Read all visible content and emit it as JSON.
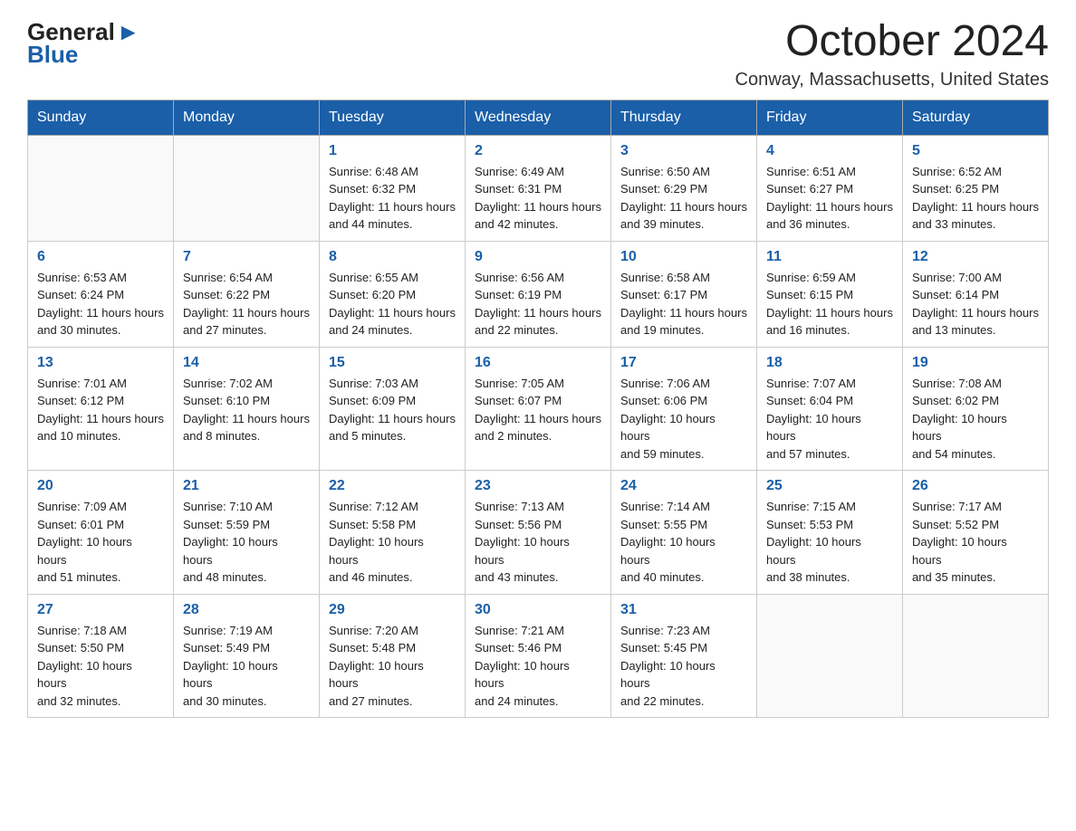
{
  "header": {
    "month_title": "October 2024",
    "location": "Conway, Massachusetts, United States",
    "logo_general": "General",
    "logo_blue": "Blue"
  },
  "days_of_week": [
    "Sunday",
    "Monday",
    "Tuesday",
    "Wednesday",
    "Thursday",
    "Friday",
    "Saturday"
  ],
  "weeks": [
    [
      {
        "day": "",
        "sunrise": "",
        "sunset": "",
        "daylight": ""
      },
      {
        "day": "",
        "sunrise": "",
        "sunset": "",
        "daylight": ""
      },
      {
        "day": "1",
        "sunrise": "Sunrise: 6:48 AM",
        "sunset": "Sunset: 6:32 PM",
        "daylight": "Daylight: 11 hours and 44 minutes."
      },
      {
        "day": "2",
        "sunrise": "Sunrise: 6:49 AM",
        "sunset": "Sunset: 6:31 PM",
        "daylight": "Daylight: 11 hours and 42 minutes."
      },
      {
        "day": "3",
        "sunrise": "Sunrise: 6:50 AM",
        "sunset": "Sunset: 6:29 PM",
        "daylight": "Daylight: 11 hours and 39 minutes."
      },
      {
        "day": "4",
        "sunrise": "Sunrise: 6:51 AM",
        "sunset": "Sunset: 6:27 PM",
        "daylight": "Daylight: 11 hours and 36 minutes."
      },
      {
        "day": "5",
        "sunrise": "Sunrise: 6:52 AM",
        "sunset": "Sunset: 6:25 PM",
        "daylight": "Daylight: 11 hours and 33 minutes."
      }
    ],
    [
      {
        "day": "6",
        "sunrise": "Sunrise: 6:53 AM",
        "sunset": "Sunset: 6:24 PM",
        "daylight": "Daylight: 11 hours and 30 minutes."
      },
      {
        "day": "7",
        "sunrise": "Sunrise: 6:54 AM",
        "sunset": "Sunset: 6:22 PM",
        "daylight": "Daylight: 11 hours and 27 minutes."
      },
      {
        "day": "8",
        "sunrise": "Sunrise: 6:55 AM",
        "sunset": "Sunset: 6:20 PM",
        "daylight": "Daylight: 11 hours and 24 minutes."
      },
      {
        "day": "9",
        "sunrise": "Sunrise: 6:56 AM",
        "sunset": "Sunset: 6:19 PM",
        "daylight": "Daylight: 11 hours and 22 minutes."
      },
      {
        "day": "10",
        "sunrise": "Sunrise: 6:58 AM",
        "sunset": "Sunset: 6:17 PM",
        "daylight": "Daylight: 11 hours and 19 minutes."
      },
      {
        "day": "11",
        "sunrise": "Sunrise: 6:59 AM",
        "sunset": "Sunset: 6:15 PM",
        "daylight": "Daylight: 11 hours and 16 minutes."
      },
      {
        "day": "12",
        "sunrise": "Sunrise: 7:00 AM",
        "sunset": "Sunset: 6:14 PM",
        "daylight": "Daylight: 11 hours and 13 minutes."
      }
    ],
    [
      {
        "day": "13",
        "sunrise": "Sunrise: 7:01 AM",
        "sunset": "Sunset: 6:12 PM",
        "daylight": "Daylight: 11 hours and 10 minutes."
      },
      {
        "day": "14",
        "sunrise": "Sunrise: 7:02 AM",
        "sunset": "Sunset: 6:10 PM",
        "daylight": "Daylight: 11 hours and 8 minutes."
      },
      {
        "day": "15",
        "sunrise": "Sunrise: 7:03 AM",
        "sunset": "Sunset: 6:09 PM",
        "daylight": "Daylight: 11 hours and 5 minutes."
      },
      {
        "day": "16",
        "sunrise": "Sunrise: 7:05 AM",
        "sunset": "Sunset: 6:07 PM",
        "daylight": "Daylight: 11 hours and 2 minutes."
      },
      {
        "day": "17",
        "sunrise": "Sunrise: 7:06 AM",
        "sunset": "Sunset: 6:06 PM",
        "daylight": "Daylight: 10 hours and 59 minutes."
      },
      {
        "day": "18",
        "sunrise": "Sunrise: 7:07 AM",
        "sunset": "Sunset: 6:04 PM",
        "daylight": "Daylight: 10 hours and 57 minutes."
      },
      {
        "day": "19",
        "sunrise": "Sunrise: 7:08 AM",
        "sunset": "Sunset: 6:02 PM",
        "daylight": "Daylight: 10 hours and 54 minutes."
      }
    ],
    [
      {
        "day": "20",
        "sunrise": "Sunrise: 7:09 AM",
        "sunset": "Sunset: 6:01 PM",
        "daylight": "Daylight: 10 hours and 51 minutes."
      },
      {
        "day": "21",
        "sunrise": "Sunrise: 7:10 AM",
        "sunset": "Sunset: 5:59 PM",
        "daylight": "Daylight: 10 hours and 48 minutes."
      },
      {
        "day": "22",
        "sunrise": "Sunrise: 7:12 AM",
        "sunset": "Sunset: 5:58 PM",
        "daylight": "Daylight: 10 hours and 46 minutes."
      },
      {
        "day": "23",
        "sunrise": "Sunrise: 7:13 AM",
        "sunset": "Sunset: 5:56 PM",
        "daylight": "Daylight: 10 hours and 43 minutes."
      },
      {
        "day": "24",
        "sunrise": "Sunrise: 7:14 AM",
        "sunset": "Sunset: 5:55 PM",
        "daylight": "Daylight: 10 hours and 40 minutes."
      },
      {
        "day": "25",
        "sunrise": "Sunrise: 7:15 AM",
        "sunset": "Sunset: 5:53 PM",
        "daylight": "Daylight: 10 hours and 38 minutes."
      },
      {
        "day": "26",
        "sunrise": "Sunrise: 7:17 AM",
        "sunset": "Sunset: 5:52 PM",
        "daylight": "Daylight: 10 hours and 35 minutes."
      }
    ],
    [
      {
        "day": "27",
        "sunrise": "Sunrise: 7:18 AM",
        "sunset": "Sunset: 5:50 PM",
        "daylight": "Daylight: 10 hours and 32 minutes."
      },
      {
        "day": "28",
        "sunrise": "Sunrise: 7:19 AM",
        "sunset": "Sunset: 5:49 PM",
        "daylight": "Daylight: 10 hours and 30 minutes."
      },
      {
        "day": "29",
        "sunrise": "Sunrise: 7:20 AM",
        "sunset": "Sunset: 5:48 PM",
        "daylight": "Daylight: 10 hours and 27 minutes."
      },
      {
        "day": "30",
        "sunrise": "Sunrise: 7:21 AM",
        "sunset": "Sunset: 5:46 PM",
        "daylight": "Daylight: 10 hours and 24 minutes."
      },
      {
        "day": "31",
        "sunrise": "Sunrise: 7:23 AM",
        "sunset": "Sunset: 5:45 PM",
        "daylight": "Daylight: 10 hours and 22 minutes."
      },
      {
        "day": "",
        "sunrise": "",
        "sunset": "",
        "daylight": ""
      },
      {
        "day": "",
        "sunrise": "",
        "sunset": "",
        "daylight": ""
      }
    ]
  ]
}
